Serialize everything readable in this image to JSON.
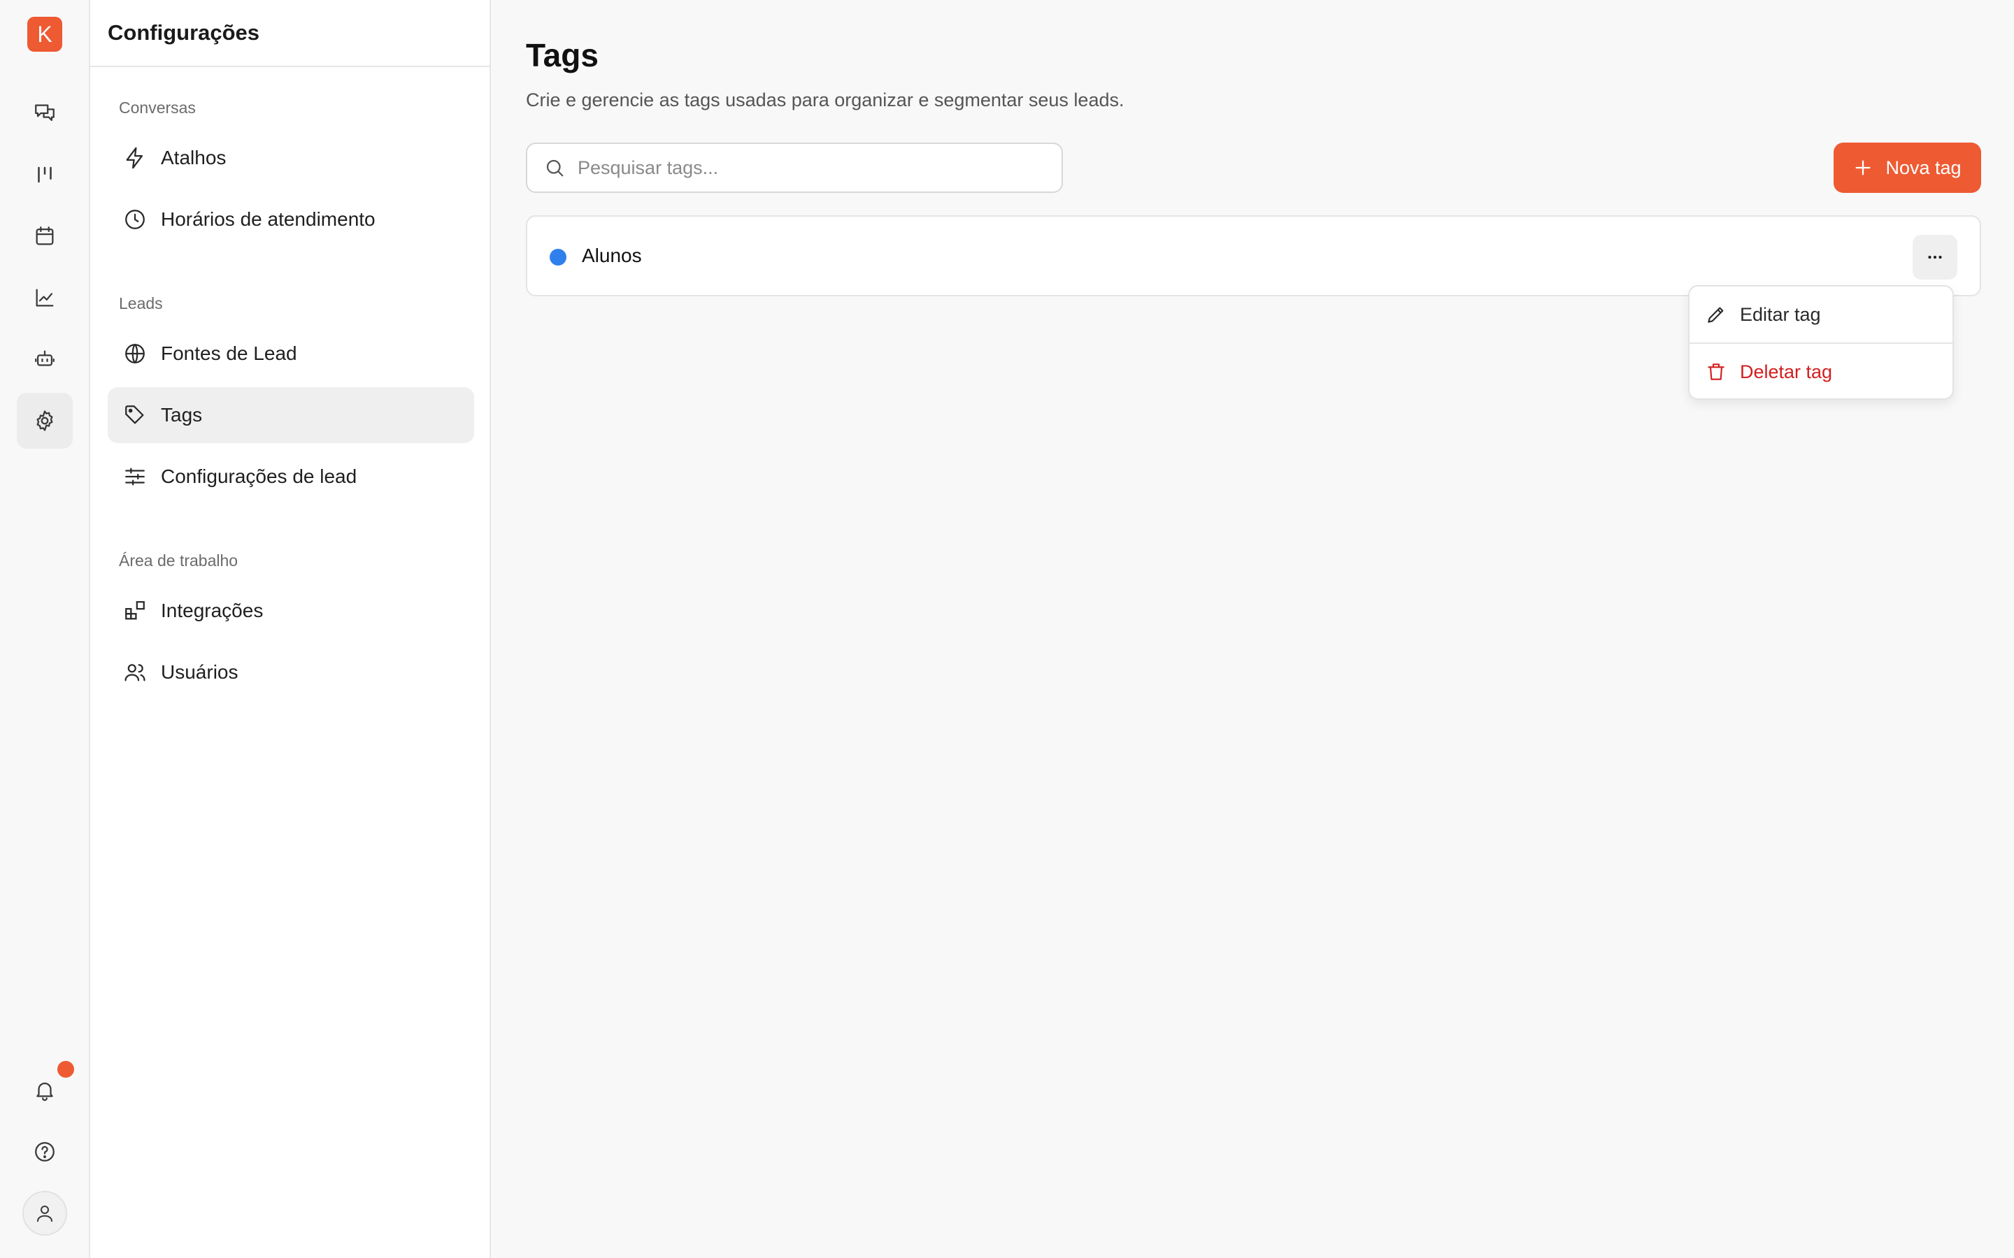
{
  "app": {
    "logo_letter": "K",
    "accent_color": "#ee5a32"
  },
  "rail": {
    "items": [
      {
        "name": "conversations",
        "icon": "chat-bubbles-icon"
      },
      {
        "name": "pipeline",
        "icon": "kanban-icon"
      },
      {
        "name": "calendar",
        "icon": "calendar-icon"
      },
      {
        "name": "reports",
        "icon": "line-chart-icon"
      },
      {
        "name": "bot",
        "icon": "bot-icon"
      },
      {
        "name": "settings",
        "icon": "gear-icon",
        "active": true
      }
    ],
    "bottom": [
      {
        "name": "notifications",
        "icon": "bell-icon",
        "has_badge": true
      },
      {
        "name": "help",
        "icon": "help-circle-icon"
      },
      {
        "name": "profile",
        "icon": "user-icon"
      }
    ]
  },
  "sidebar": {
    "title": "Configurações",
    "sections": [
      {
        "label": "Conversas",
        "items": [
          {
            "label": "Atalhos",
            "icon": "lightning-icon"
          },
          {
            "label": "Horários de atendimento",
            "icon": "clock-icon"
          }
        ]
      },
      {
        "label": "Leads",
        "items": [
          {
            "label": "Fontes de Lead",
            "icon": "globe-icon"
          },
          {
            "label": "Tags",
            "icon": "tag-icon",
            "active": true
          },
          {
            "label": "Configurações de lead",
            "icon": "sliders-icon"
          }
        ]
      },
      {
        "label": "Área de trabalho",
        "items": [
          {
            "label": "Integrações",
            "icon": "blocks-icon"
          },
          {
            "label": "Usuários",
            "icon": "users-icon"
          }
        ]
      }
    ]
  },
  "main": {
    "title": "Tags",
    "description": "Crie e gerencie as tags usadas para organizar e segmentar seus leads.",
    "search": {
      "placeholder": "Pesquisar tags...",
      "value": ""
    },
    "new_button_label": "Nova tag",
    "tags": [
      {
        "name": "Alunos",
        "color": "#2f80ed"
      }
    ],
    "context_menu": {
      "edit_label": "Editar tag",
      "delete_label": "Deletar tag",
      "delete_color": "#d21f1f"
    }
  }
}
